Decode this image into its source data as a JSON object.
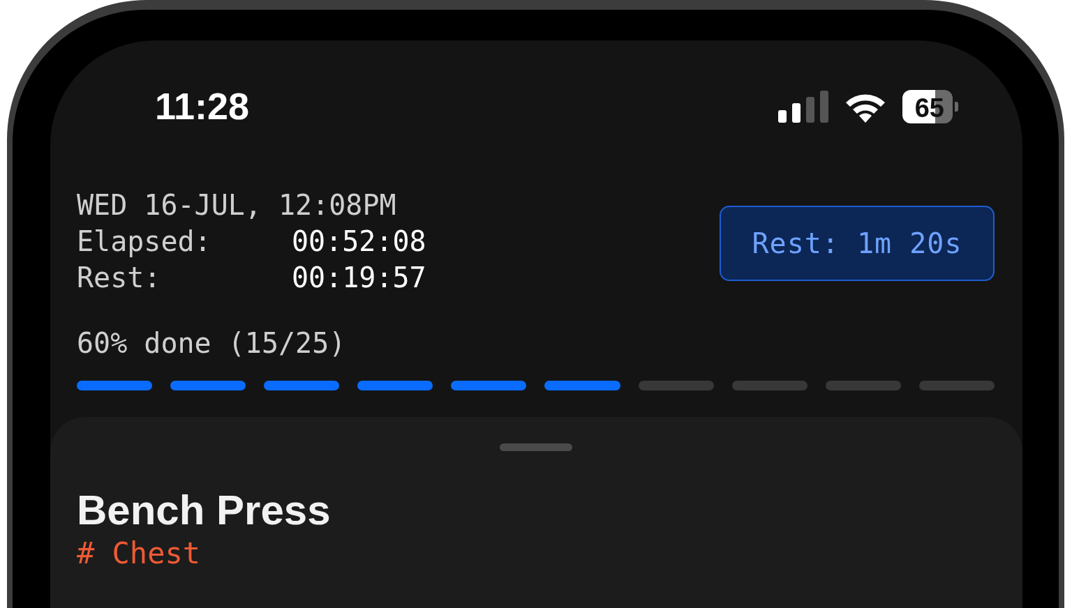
{
  "status_bar": {
    "time": "11:28",
    "battery": "65"
  },
  "header": {
    "date": "WED 16-JUL, 12:08PM",
    "elapsed_label": "Elapsed:",
    "elapsed_value": "00:52:08",
    "rest_label": "Rest:",
    "rest_value": "00:19:57"
  },
  "rest_button": {
    "label": "Rest: 1m 20s"
  },
  "progress": {
    "label": "60% done (15/25)",
    "segments": [
      {
        "filled": true
      },
      {
        "filled": true
      },
      {
        "filled": true
      },
      {
        "filled": true
      },
      {
        "filled": true
      },
      {
        "filled": true
      },
      {
        "filled": false
      },
      {
        "filled": false
      },
      {
        "filled": false
      },
      {
        "filled": false
      }
    ]
  },
  "sheet": {
    "title": "Bench Press",
    "tag": "# Chest"
  }
}
